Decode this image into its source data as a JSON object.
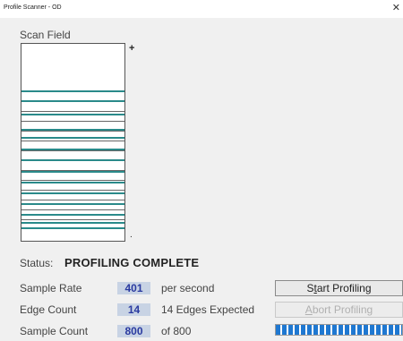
{
  "window": {
    "title": "Profile Scanner - OD"
  },
  "scan_field": {
    "label": "Scan Field",
    "top_marker": "+",
    "bottom_marker": "."
  },
  "status": {
    "label": "Status:",
    "value": "PROFILING COMPLETE"
  },
  "sample_rate": {
    "label": "Sample Rate",
    "value": "401",
    "suffix": "per second"
  },
  "edge_count": {
    "label": "Edge Count",
    "value": "14",
    "suffix": "14 Edges Expected"
  },
  "sample_count": {
    "label": "Sample Count",
    "value": "800",
    "suffix": "of 800"
  },
  "buttons": {
    "start_prefix": "S",
    "start_accel": "t",
    "start_rest": "art Profiling",
    "abort_accel": "A",
    "abort_rest": "bort Profiling"
  },
  "progress": {
    "fraction": 1.0
  },
  "colors": {
    "edge_line": "#2a8a8a",
    "value_box": "#c8d3e4",
    "value_text": "#2a3aa0",
    "progress": "#1f78d1"
  }
}
